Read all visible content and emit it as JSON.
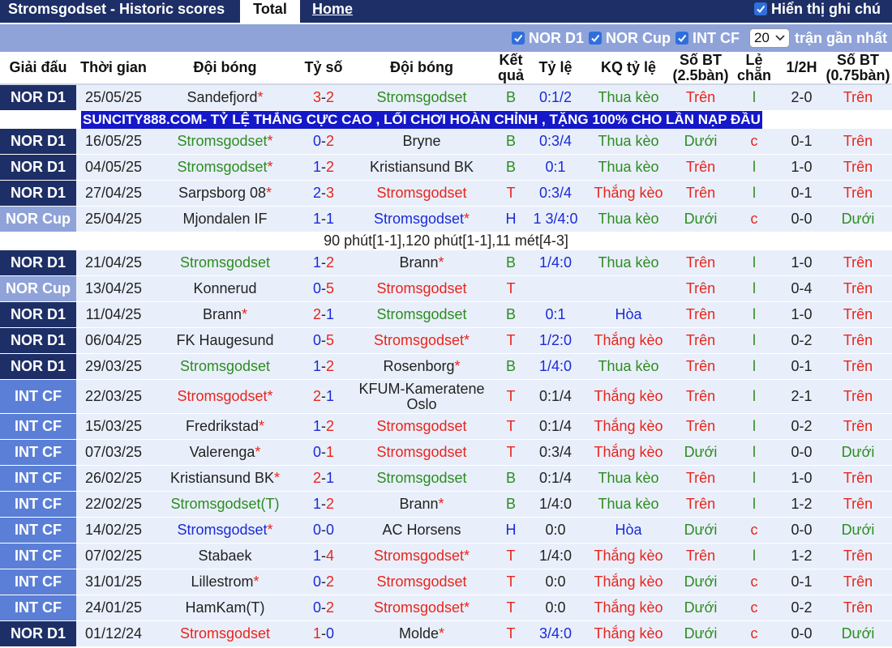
{
  "header": {
    "title": "Stromsgodset - Historic scores",
    "tab_total": "Total",
    "tab_home": "Home",
    "hien_thi": "Hiển thị ghi chú"
  },
  "filters": {
    "nor_d1": "NOR D1",
    "nor_cup": "NOR Cup",
    "int_cf": "INT CF",
    "count_value": "20",
    "count_suffix": "trận gần nhất"
  },
  "columns": {
    "league": "Giải đấu",
    "time": "Thời gian",
    "home": "Đội bóng",
    "score": "Tỷ số",
    "away": "Đội bóng",
    "result": "Kết quả",
    "odds": "Tỷ lệ",
    "odds_result": "KQ tỷ lệ",
    "goals": "Số BT (2.5bàn)",
    "oddeven": "Lẻ chẵn",
    "half": "1/2H",
    "goals75": "Số BT (0.75bàn)"
  },
  "ad_text": "SUNCITY888.COM- TỶ LỆ THẮNG CỰC CAO , LỐI CHƠI HOÀN CHỈNH , TẶNG 100% CHO LẦN NẠP ĐẦU",
  "note_text": "90 phút[1-1],120 phút[1-1],11 mét[4-3]",
  "colors": {
    "navy": "#1d2f66",
    "cup": "#8fa3d9",
    "intcf": "#5b7fd6",
    "red": "#e8251d",
    "green": "#2c8c21",
    "blue": "#1a2ad8"
  },
  "rows": [
    {
      "league": "NOR D1",
      "lc": "d1",
      "date": "25/05/25",
      "home": "Sandefjord",
      "hstar": true,
      "hc": "dark",
      "s1": "3",
      "s2": "2",
      "s1c": "red",
      "s2c": "red",
      "away": "Stromsgodset",
      "astar": false,
      "ac": "green",
      "res": "B",
      "resc": "green",
      "odds": "0:1/2",
      "oddsc": "blue",
      "kq": "Thua kèo",
      "kqc": "green",
      "bt": "Trên",
      "btc": "red",
      "le": "l",
      "lec": "green",
      "half": "2-0",
      "bt75": "Trên",
      "bt75c": "red"
    },
    {
      "league": "NOR D1",
      "lc": "d1",
      "date": "16/05/25",
      "home": "Stromsgodset",
      "hstar": true,
      "hc": "green",
      "s1": "0",
      "s2": "2",
      "s1c": "blue",
      "s2c": "red",
      "away": "Bryne",
      "astar": false,
      "ac": "dark",
      "res": "B",
      "resc": "green",
      "odds": "0:3/4",
      "oddsc": "blue",
      "kq": "Thua kèo",
      "kqc": "green",
      "bt": "Dưới",
      "btc": "green",
      "le": "c",
      "lec": "red",
      "half": "0-1",
      "bt75": "Trên",
      "bt75c": "red"
    },
    {
      "league": "NOR D1",
      "lc": "d1",
      "date": "04/05/25",
      "home": "Stromsgodset",
      "hstar": true,
      "hc": "green",
      "s1": "1",
      "s2": "2",
      "s1c": "blue",
      "s2c": "red",
      "away": "Kristiansund BK",
      "astar": false,
      "ac": "dark",
      "res": "B",
      "resc": "green",
      "odds": "0:1",
      "oddsc": "blue",
      "kq": "Thua kèo",
      "kqc": "green",
      "bt": "Trên",
      "btc": "red",
      "le": "l",
      "lec": "green",
      "half": "1-0",
      "bt75": "Trên",
      "bt75c": "red"
    },
    {
      "league": "NOR D1",
      "lc": "d1",
      "date": "27/04/25",
      "home": "Sarpsborg 08",
      "hstar": true,
      "hc": "dark",
      "s1": "2",
      "s2": "3",
      "s1c": "blue",
      "s2c": "red",
      "away": "Stromsgodset",
      "astar": false,
      "ac": "red",
      "res": "T",
      "resc": "red",
      "odds": "0:3/4",
      "oddsc": "blue",
      "kq": "Thắng kèo",
      "kqc": "red",
      "bt": "Trên",
      "btc": "red",
      "le": "l",
      "lec": "green",
      "half": "0-1",
      "bt75": "Trên",
      "bt75c": "red"
    },
    {
      "league": "NOR Cup",
      "lc": "cup",
      "date": "25/04/25",
      "home": "Mjondalen IF",
      "hstar": false,
      "hc": "dark",
      "s1": "1",
      "s2": "1",
      "s1c": "blue",
      "s2c": "blue",
      "away": "Stromsgodset",
      "astar": true,
      "ac": "blue",
      "res": "H",
      "resc": "blue",
      "odds": "1 3/4:0",
      "oddsc": "blue",
      "kq": "Thua kèo",
      "kqc": "green",
      "bt": "Dưới",
      "btc": "green",
      "le": "c",
      "lec": "red",
      "half": "0-0",
      "bt75": "Dưới",
      "bt75c": "green"
    },
    {
      "league": "NOR D1",
      "lc": "d1",
      "date": "21/04/25",
      "home": "Stromsgodset",
      "hstar": false,
      "hc": "green",
      "s1": "1",
      "s2": "2",
      "s1c": "blue",
      "s2c": "red",
      "away": "Brann",
      "astar": true,
      "ac": "dark",
      "res": "B",
      "resc": "green",
      "odds": "1/4:0",
      "oddsc": "blue",
      "kq": "Thua kèo",
      "kqc": "green",
      "bt": "Trên",
      "btc": "red",
      "le": "l",
      "lec": "green",
      "half": "1-0",
      "bt75": "Trên",
      "bt75c": "red"
    },
    {
      "league": "NOR Cup",
      "lc": "cup",
      "date": "13/04/25",
      "home": "Konnerud",
      "hstar": false,
      "hc": "dark",
      "s1": "0",
      "s2": "5",
      "s1c": "blue",
      "s2c": "red",
      "away": "Stromsgodset",
      "astar": false,
      "ac": "red",
      "res": "T",
      "resc": "red",
      "odds": "",
      "oddsc": "blue",
      "kq": "",
      "kqc": "green",
      "bt": "Trên",
      "btc": "red",
      "le": "l",
      "lec": "green",
      "half": "0-4",
      "bt75": "Trên",
      "bt75c": "red"
    },
    {
      "league": "NOR D1",
      "lc": "d1",
      "date": "11/04/25",
      "home": "Brann",
      "hstar": true,
      "hc": "dark",
      "s1": "2",
      "s2": "1",
      "s1c": "red",
      "s2c": "blue",
      "away": "Stromsgodset",
      "astar": false,
      "ac": "green",
      "res": "B",
      "resc": "green",
      "odds": "0:1",
      "oddsc": "blue",
      "kq": "Hòa",
      "kqc": "blue",
      "bt": "Trên",
      "btc": "red",
      "le": "l",
      "lec": "green",
      "half": "1-0",
      "bt75": "Trên",
      "bt75c": "red"
    },
    {
      "league": "NOR D1",
      "lc": "d1",
      "date": "06/04/25",
      "home": "FK Haugesund",
      "hstar": false,
      "hc": "dark",
      "s1": "0",
      "s2": "5",
      "s1c": "blue",
      "s2c": "red",
      "away": "Stromsgodset",
      "astar": true,
      "ac": "red",
      "res": "T",
      "resc": "red",
      "odds": "1/2:0",
      "oddsc": "blue",
      "kq": "Thắng kèo",
      "kqc": "red",
      "bt": "Trên",
      "btc": "red",
      "le": "l",
      "lec": "green",
      "half": "0-2",
      "bt75": "Trên",
      "bt75c": "red"
    },
    {
      "league": "NOR D1",
      "lc": "d1",
      "date": "29/03/25",
      "home": "Stromsgodset",
      "hstar": false,
      "hc": "green",
      "s1": "1",
      "s2": "2",
      "s1c": "blue",
      "s2c": "red",
      "away": "Rosenborg",
      "astar": true,
      "ac": "dark",
      "res": "B",
      "resc": "green",
      "odds": "1/4:0",
      "oddsc": "blue",
      "kq": "Thua kèo",
      "kqc": "green",
      "bt": "Trên",
      "btc": "red",
      "le": "l",
      "lec": "green",
      "half": "0-1",
      "bt75": "Trên",
      "bt75c": "red"
    },
    {
      "league": "INT CF",
      "lc": "intcf",
      "date": "22/03/25",
      "home": "Stromsgodset",
      "hstar": true,
      "hc": "red",
      "s1": "2",
      "s2": "1",
      "s1c": "red",
      "s2c": "blue",
      "away": "KFUM-Kameratene Oslo",
      "astar": false,
      "ac": "dark",
      "res": "T",
      "resc": "red",
      "odds": "0:1/4",
      "oddsc": "dark",
      "kq": "Thắng kèo",
      "kqc": "red",
      "bt": "Trên",
      "btc": "red",
      "le": "l",
      "lec": "green",
      "half": "2-1",
      "bt75": "Trên",
      "bt75c": "red",
      "tall": true
    },
    {
      "league": "INT CF",
      "lc": "intcf",
      "date": "15/03/25",
      "home": "Fredrikstad",
      "hstar": true,
      "hc": "dark",
      "s1": "1",
      "s2": "2",
      "s1c": "blue",
      "s2c": "red",
      "away": "Stromsgodset",
      "astar": false,
      "ac": "red",
      "res": "T",
      "resc": "red",
      "odds": "0:1/4",
      "oddsc": "dark",
      "kq": "Thắng kèo",
      "kqc": "red",
      "bt": "Trên",
      "btc": "red",
      "le": "l",
      "lec": "green",
      "half": "0-2",
      "bt75": "Trên",
      "bt75c": "red"
    },
    {
      "league": "INT CF",
      "lc": "intcf",
      "date": "07/03/25",
      "home": "Valerenga",
      "hstar": true,
      "hc": "dark",
      "s1": "0",
      "s2": "1",
      "s1c": "blue",
      "s2c": "red",
      "away": "Stromsgodset",
      "astar": false,
      "ac": "red",
      "res": "T",
      "resc": "red",
      "odds": "0:3/4",
      "oddsc": "dark",
      "kq": "Thắng kèo",
      "kqc": "red",
      "bt": "Dưới",
      "btc": "green",
      "le": "l",
      "lec": "green",
      "half": "0-0",
      "bt75": "Dưới",
      "bt75c": "green"
    },
    {
      "league": "INT CF",
      "lc": "intcf",
      "date": "26/02/25",
      "home": "Kristiansund BK",
      "hstar": true,
      "hc": "dark",
      "s1": "2",
      "s2": "1",
      "s1c": "red",
      "s2c": "blue",
      "away": "Stromsgodset",
      "astar": false,
      "ac": "green",
      "res": "B",
      "resc": "green",
      "odds": "0:1/4",
      "oddsc": "dark",
      "kq": "Thua kèo",
      "kqc": "green",
      "bt": "Trên",
      "btc": "red",
      "le": "l",
      "lec": "green",
      "half": "1-0",
      "bt75": "Trên",
      "bt75c": "red"
    },
    {
      "league": "INT CF",
      "lc": "intcf",
      "date": "22/02/25",
      "home": "Stromsgodset(T)",
      "hstar": false,
      "hc": "green",
      "s1": "1",
      "s2": "2",
      "s1c": "blue",
      "s2c": "red",
      "away": "Brann",
      "astar": true,
      "ac": "dark",
      "res": "B",
      "resc": "green",
      "odds": "1/4:0",
      "oddsc": "dark",
      "kq": "Thua kèo",
      "kqc": "green",
      "bt": "Trên",
      "btc": "red",
      "le": "l",
      "lec": "green",
      "half": "1-2",
      "bt75": "Trên",
      "bt75c": "red"
    },
    {
      "league": "INT CF",
      "lc": "intcf",
      "date": "14/02/25",
      "home": "Stromsgodset",
      "hstar": true,
      "hc": "blue",
      "s1": "0",
      "s2": "0",
      "s1c": "blue",
      "s2c": "blue",
      "away": "AC Horsens",
      "astar": false,
      "ac": "dark",
      "res": "H",
      "resc": "blue",
      "odds": "0:0",
      "oddsc": "dark",
      "kq": "Hòa",
      "kqc": "blue",
      "bt": "Dưới",
      "btc": "green",
      "le": "c",
      "lec": "red",
      "half": "0-0",
      "bt75": "Dưới",
      "bt75c": "green"
    },
    {
      "league": "INT CF",
      "lc": "intcf",
      "date": "07/02/25",
      "home": "Stabaek",
      "hstar": false,
      "hc": "dark",
      "s1": "1",
      "s2": "4",
      "s1c": "blue",
      "s2c": "red",
      "away": "Stromsgodset",
      "astar": true,
      "ac": "red",
      "res": "T",
      "resc": "red",
      "odds": "1/4:0",
      "oddsc": "dark",
      "kq": "Thắng kèo",
      "kqc": "red",
      "bt": "Trên",
      "btc": "red",
      "le": "l",
      "lec": "green",
      "half": "1-2",
      "bt75": "Trên",
      "bt75c": "red"
    },
    {
      "league": "INT CF",
      "lc": "intcf",
      "date": "31/01/25",
      "home": "Lillestrom",
      "hstar": true,
      "hc": "dark",
      "s1": "0",
      "s2": "2",
      "s1c": "blue",
      "s2c": "red",
      "away": "Stromsgodset",
      "astar": false,
      "ac": "red",
      "res": "T",
      "resc": "red",
      "odds": "0:0",
      "oddsc": "dark",
      "kq": "Thắng kèo",
      "kqc": "red",
      "bt": "Dưới",
      "btc": "green",
      "le": "c",
      "lec": "red",
      "half": "0-1",
      "bt75": "Trên",
      "bt75c": "red"
    },
    {
      "league": "INT CF",
      "lc": "intcf",
      "date": "24/01/25",
      "home": "HamKam(T)",
      "hstar": false,
      "hc": "dark",
      "s1": "0",
      "s2": "2",
      "s1c": "blue",
      "s2c": "red",
      "away": "Stromsgodset",
      "astar": true,
      "ac": "red",
      "res": "T",
      "resc": "red",
      "odds": "0:0",
      "oddsc": "dark",
      "kq": "Thắng kèo",
      "kqc": "red",
      "bt": "Dưới",
      "btc": "green",
      "le": "c",
      "lec": "red",
      "half": "0-2",
      "bt75": "Trên",
      "bt75c": "red"
    },
    {
      "league": "NOR D1",
      "lc": "d1",
      "date": "01/12/24",
      "home": "Stromsgodset",
      "hstar": false,
      "hc": "red",
      "s1": "1",
      "s2": "0",
      "s1c": "red",
      "s2c": "blue",
      "away": "Molde",
      "astar": true,
      "ac": "dark",
      "res": "T",
      "resc": "red",
      "odds": "3/4:0",
      "oddsc": "blue",
      "kq": "Thắng kèo",
      "kqc": "red",
      "bt": "Dưới",
      "btc": "green",
      "le": "c",
      "lec": "red",
      "half": "0-0",
      "bt75": "Dưới",
      "bt75c": "green"
    }
  ]
}
